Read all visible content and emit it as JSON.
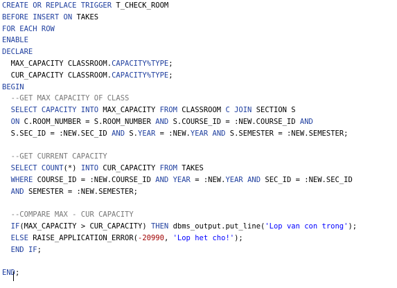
{
  "editor": {
    "colors": {
      "keyword": "#1f3f9f",
      "comment": "#777777",
      "string": "#0000ff",
      "number": "#a00000",
      "plain": "#000000",
      "background": "#ffffff"
    },
    "lines": [
      {
        "indent": "",
        "tokens": [
          {
            "t": "kw",
            "v": "CREATE OR REPLACE TRIGGER"
          },
          {
            "t": "tx",
            "v": " T_CHECK_ROOM"
          }
        ]
      },
      {
        "indent": "",
        "tokens": [
          {
            "t": "kw",
            "v": "BEFORE INSERT ON"
          },
          {
            "t": "tx",
            "v": " TAKES"
          }
        ]
      },
      {
        "indent": "",
        "tokens": [
          {
            "t": "kw",
            "v": "FOR EACH ROW"
          }
        ]
      },
      {
        "indent": "",
        "tokens": [
          {
            "t": "kw",
            "v": "ENABLE"
          }
        ]
      },
      {
        "indent": "",
        "tokens": [
          {
            "t": "kw",
            "v": "DECLARE"
          }
        ]
      },
      {
        "indent": "  ",
        "tokens": [
          {
            "t": "tx",
            "v": "MAX_CAPACITY CLASSROOM."
          },
          {
            "t": "kw",
            "v": "CAPACITY%TYPE"
          },
          {
            "t": "tx",
            "v": ";"
          }
        ]
      },
      {
        "indent": "  ",
        "tokens": [
          {
            "t": "tx",
            "v": "CUR_CAPACITY CLASSROOM."
          },
          {
            "t": "kw",
            "v": "CAPACITY%TYPE"
          },
          {
            "t": "tx",
            "v": ";"
          }
        ]
      },
      {
        "indent": "",
        "tokens": [
          {
            "t": "kw",
            "v": "BEGIN"
          }
        ]
      },
      {
        "indent": "  ",
        "tokens": [
          {
            "t": "cm",
            "v": "--GET MAX CAPACITY OF CLASS"
          }
        ]
      },
      {
        "indent": "  ",
        "tokens": [
          {
            "t": "kw",
            "v": "SELECT CAPACITY INTO"
          },
          {
            "t": "tx",
            "v": " MAX_CAPACITY "
          },
          {
            "t": "kw",
            "v": "FROM"
          },
          {
            "t": "tx",
            "v": " CLASSROOM "
          },
          {
            "t": "kw",
            "v": "C JOIN"
          },
          {
            "t": "tx",
            "v": " SECTION S"
          }
        ]
      },
      {
        "indent": "  ",
        "tokens": [
          {
            "t": "kw",
            "v": "ON"
          },
          {
            "t": "tx",
            "v": " C.ROOM_NUMBER = S.ROOM_NUMBER "
          },
          {
            "t": "kw",
            "v": "AND"
          },
          {
            "t": "tx",
            "v": " S.COURSE_ID = :NEW.COURSE_ID "
          },
          {
            "t": "kw",
            "v": "AND"
          }
        ]
      },
      {
        "indent": "  ",
        "tokens": [
          {
            "t": "tx",
            "v": "S.SEC_ID = :NEW.SEC_ID "
          },
          {
            "t": "kw",
            "v": "AND"
          },
          {
            "t": "tx",
            "v": " S."
          },
          {
            "t": "kw",
            "v": "YEAR"
          },
          {
            "t": "tx",
            "v": " = :NEW."
          },
          {
            "t": "kw",
            "v": "YEAR"
          },
          {
            "t": "tx",
            "v": " "
          },
          {
            "t": "kw",
            "v": "AND"
          },
          {
            "t": "tx",
            "v": " S.SEMESTER = :NEW.SEMESTER;"
          }
        ]
      },
      {
        "indent": "",
        "tokens": []
      },
      {
        "indent": "  ",
        "tokens": [
          {
            "t": "cm",
            "v": "--GET CURRENT CAPACITY"
          }
        ]
      },
      {
        "indent": "  ",
        "tokens": [
          {
            "t": "kw",
            "v": "SELECT COUNT"
          },
          {
            "t": "tx",
            "v": "(*) "
          },
          {
            "t": "kw",
            "v": "INTO"
          },
          {
            "t": "tx",
            "v": " CUR_CAPACITY "
          },
          {
            "t": "kw",
            "v": "FROM"
          },
          {
            "t": "tx",
            "v": " TAKES"
          }
        ]
      },
      {
        "indent": "  ",
        "tokens": [
          {
            "t": "kw",
            "v": "WHERE"
          },
          {
            "t": "tx",
            "v": " COURSE_ID = :NEW.COURSE_ID "
          },
          {
            "t": "kw",
            "v": "AND"
          },
          {
            "t": "tx",
            "v": " "
          },
          {
            "t": "kw",
            "v": "YEAR"
          },
          {
            "t": "tx",
            "v": " = :NEW."
          },
          {
            "t": "kw",
            "v": "YEAR"
          },
          {
            "t": "tx",
            "v": " "
          },
          {
            "t": "kw",
            "v": "AND"
          },
          {
            "t": "tx",
            "v": " SEC_ID = :NEW.SEC_ID"
          }
        ]
      },
      {
        "indent": "  ",
        "tokens": [
          {
            "t": "kw",
            "v": "AND"
          },
          {
            "t": "tx",
            "v": " SEMESTER = :NEW.SEMESTER;"
          }
        ]
      },
      {
        "indent": "",
        "tokens": []
      },
      {
        "indent": "  ",
        "tokens": [
          {
            "t": "cm",
            "v": "--COMPARE MAX - CUR CAPACITY"
          }
        ]
      },
      {
        "indent": "  ",
        "tokens": [
          {
            "t": "kw",
            "v": "IF"
          },
          {
            "t": "tx",
            "v": "(MAX_CAPACITY > CUR_CAPACITY) "
          },
          {
            "t": "kw",
            "v": "THEN"
          },
          {
            "t": "tx",
            "v": " dbms_output.put_line("
          },
          {
            "t": "st",
            "v": "'Lop van con trong'"
          },
          {
            "t": "tx",
            "v": ");"
          }
        ]
      },
      {
        "indent": "  ",
        "tokens": [
          {
            "t": "kw",
            "v": "ELSE"
          },
          {
            "t": "tx",
            "v": " RAISE_APPLICATION_ERROR("
          },
          {
            "t": "nm",
            "v": "-20990"
          },
          {
            "t": "tx",
            "v": ", "
          },
          {
            "t": "st",
            "v": "'Lop het cho!'"
          },
          {
            "t": "tx",
            "v": ");"
          }
        ]
      },
      {
        "indent": "  ",
        "tokens": [
          {
            "t": "kw",
            "v": "END IF"
          },
          {
            "t": "tx",
            "v": ";"
          }
        ]
      },
      {
        "indent": "",
        "tokens": []
      },
      {
        "indent": "",
        "tokens": [
          {
            "t": "kw",
            "v": "END"
          },
          {
            "t": "tx",
            "v": ";"
          }
        ]
      }
    ]
  }
}
